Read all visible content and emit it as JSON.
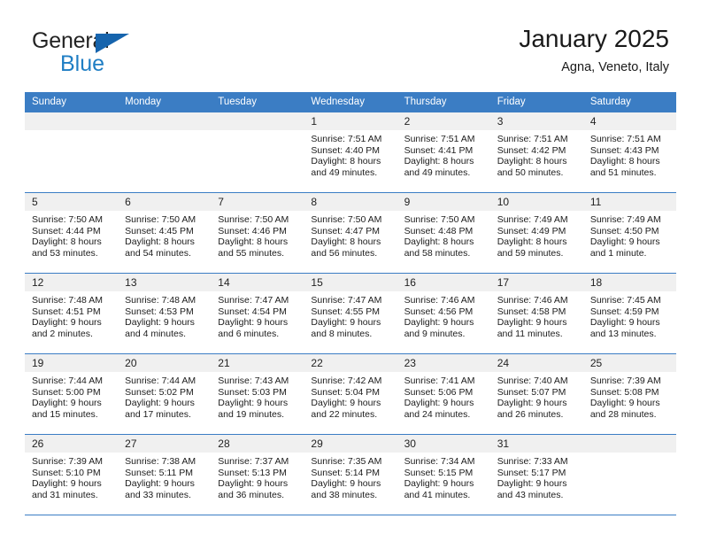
{
  "brand": {
    "name_top": "General",
    "name_bottom": "Blue",
    "triangle_color": "#1664ad",
    "blue_color": "#1f7ec4"
  },
  "header": {
    "title": "January 2025",
    "subtitle": "Agna, Veneto, Italy"
  },
  "theme": {
    "header_row_bg": "#3b7dc4",
    "header_row_text": "#ffffff",
    "daynum_bg": "#f0f0f0",
    "grid_line": "#3b7dc4"
  },
  "calendar": {
    "weekday_headers": [
      "Sunday",
      "Monday",
      "Tuesday",
      "Wednesday",
      "Thursday",
      "Friday",
      "Saturday"
    ],
    "labels": {
      "sunrise": "Sunrise:",
      "sunset": "Sunset:",
      "daylight": "Daylight:"
    },
    "weeks": [
      [
        {
          "day": "",
          "sunrise": "",
          "sunset": "",
          "daylight_line1": "",
          "daylight_line2": ""
        },
        {
          "day": "",
          "sunrise": "",
          "sunset": "",
          "daylight_line1": "",
          "daylight_line2": ""
        },
        {
          "day": "",
          "sunrise": "",
          "sunset": "",
          "daylight_line1": "",
          "daylight_line2": ""
        },
        {
          "day": "1",
          "sunrise": "Sunrise: 7:51 AM",
          "sunset": "Sunset: 4:40 PM",
          "daylight_line1": "Daylight: 8 hours",
          "daylight_line2": "and 49 minutes."
        },
        {
          "day": "2",
          "sunrise": "Sunrise: 7:51 AM",
          "sunset": "Sunset: 4:41 PM",
          "daylight_line1": "Daylight: 8 hours",
          "daylight_line2": "and 49 minutes."
        },
        {
          "day": "3",
          "sunrise": "Sunrise: 7:51 AM",
          "sunset": "Sunset: 4:42 PM",
          "daylight_line1": "Daylight: 8 hours",
          "daylight_line2": "and 50 minutes."
        },
        {
          "day": "4",
          "sunrise": "Sunrise: 7:51 AM",
          "sunset": "Sunset: 4:43 PM",
          "daylight_line1": "Daylight: 8 hours",
          "daylight_line2": "and 51 minutes."
        }
      ],
      [
        {
          "day": "5",
          "sunrise": "Sunrise: 7:50 AM",
          "sunset": "Sunset: 4:44 PM",
          "daylight_line1": "Daylight: 8 hours",
          "daylight_line2": "and 53 minutes."
        },
        {
          "day": "6",
          "sunrise": "Sunrise: 7:50 AM",
          "sunset": "Sunset: 4:45 PM",
          "daylight_line1": "Daylight: 8 hours",
          "daylight_line2": "and 54 minutes."
        },
        {
          "day": "7",
          "sunrise": "Sunrise: 7:50 AM",
          "sunset": "Sunset: 4:46 PM",
          "daylight_line1": "Daylight: 8 hours",
          "daylight_line2": "and 55 minutes."
        },
        {
          "day": "8",
          "sunrise": "Sunrise: 7:50 AM",
          "sunset": "Sunset: 4:47 PM",
          "daylight_line1": "Daylight: 8 hours",
          "daylight_line2": "and 56 minutes."
        },
        {
          "day": "9",
          "sunrise": "Sunrise: 7:50 AM",
          "sunset": "Sunset: 4:48 PM",
          "daylight_line1": "Daylight: 8 hours",
          "daylight_line2": "and 58 minutes."
        },
        {
          "day": "10",
          "sunrise": "Sunrise: 7:49 AM",
          "sunset": "Sunset: 4:49 PM",
          "daylight_line1": "Daylight: 8 hours",
          "daylight_line2": "and 59 minutes."
        },
        {
          "day": "11",
          "sunrise": "Sunrise: 7:49 AM",
          "sunset": "Sunset: 4:50 PM",
          "daylight_line1": "Daylight: 9 hours",
          "daylight_line2": "and 1 minute."
        }
      ],
      [
        {
          "day": "12",
          "sunrise": "Sunrise: 7:48 AM",
          "sunset": "Sunset: 4:51 PM",
          "daylight_line1": "Daylight: 9 hours",
          "daylight_line2": "and 2 minutes."
        },
        {
          "day": "13",
          "sunrise": "Sunrise: 7:48 AM",
          "sunset": "Sunset: 4:53 PM",
          "daylight_line1": "Daylight: 9 hours",
          "daylight_line2": "and 4 minutes."
        },
        {
          "day": "14",
          "sunrise": "Sunrise: 7:47 AM",
          "sunset": "Sunset: 4:54 PM",
          "daylight_line1": "Daylight: 9 hours",
          "daylight_line2": "and 6 minutes."
        },
        {
          "day": "15",
          "sunrise": "Sunrise: 7:47 AM",
          "sunset": "Sunset: 4:55 PM",
          "daylight_line1": "Daylight: 9 hours",
          "daylight_line2": "and 8 minutes."
        },
        {
          "day": "16",
          "sunrise": "Sunrise: 7:46 AM",
          "sunset": "Sunset: 4:56 PM",
          "daylight_line1": "Daylight: 9 hours",
          "daylight_line2": "and 9 minutes."
        },
        {
          "day": "17",
          "sunrise": "Sunrise: 7:46 AM",
          "sunset": "Sunset: 4:58 PM",
          "daylight_line1": "Daylight: 9 hours",
          "daylight_line2": "and 11 minutes."
        },
        {
          "day": "18",
          "sunrise": "Sunrise: 7:45 AM",
          "sunset": "Sunset: 4:59 PM",
          "daylight_line1": "Daylight: 9 hours",
          "daylight_line2": "and 13 minutes."
        }
      ],
      [
        {
          "day": "19",
          "sunrise": "Sunrise: 7:44 AM",
          "sunset": "Sunset: 5:00 PM",
          "daylight_line1": "Daylight: 9 hours",
          "daylight_line2": "and 15 minutes."
        },
        {
          "day": "20",
          "sunrise": "Sunrise: 7:44 AM",
          "sunset": "Sunset: 5:02 PM",
          "daylight_line1": "Daylight: 9 hours",
          "daylight_line2": "and 17 minutes."
        },
        {
          "day": "21",
          "sunrise": "Sunrise: 7:43 AM",
          "sunset": "Sunset: 5:03 PM",
          "daylight_line1": "Daylight: 9 hours",
          "daylight_line2": "and 19 minutes."
        },
        {
          "day": "22",
          "sunrise": "Sunrise: 7:42 AM",
          "sunset": "Sunset: 5:04 PM",
          "daylight_line1": "Daylight: 9 hours",
          "daylight_line2": "and 22 minutes."
        },
        {
          "day": "23",
          "sunrise": "Sunrise: 7:41 AM",
          "sunset": "Sunset: 5:06 PM",
          "daylight_line1": "Daylight: 9 hours",
          "daylight_line2": "and 24 minutes."
        },
        {
          "day": "24",
          "sunrise": "Sunrise: 7:40 AM",
          "sunset": "Sunset: 5:07 PM",
          "daylight_line1": "Daylight: 9 hours",
          "daylight_line2": "and 26 minutes."
        },
        {
          "day": "25",
          "sunrise": "Sunrise: 7:39 AM",
          "sunset": "Sunset: 5:08 PM",
          "daylight_line1": "Daylight: 9 hours",
          "daylight_line2": "and 28 minutes."
        }
      ],
      [
        {
          "day": "26",
          "sunrise": "Sunrise: 7:39 AM",
          "sunset": "Sunset: 5:10 PM",
          "daylight_line1": "Daylight: 9 hours",
          "daylight_line2": "and 31 minutes."
        },
        {
          "day": "27",
          "sunrise": "Sunrise: 7:38 AM",
          "sunset": "Sunset: 5:11 PM",
          "daylight_line1": "Daylight: 9 hours",
          "daylight_line2": "and 33 minutes."
        },
        {
          "day": "28",
          "sunrise": "Sunrise: 7:37 AM",
          "sunset": "Sunset: 5:13 PM",
          "daylight_line1": "Daylight: 9 hours",
          "daylight_line2": "and 36 minutes."
        },
        {
          "day": "29",
          "sunrise": "Sunrise: 7:35 AM",
          "sunset": "Sunset: 5:14 PM",
          "daylight_line1": "Daylight: 9 hours",
          "daylight_line2": "and 38 minutes."
        },
        {
          "day": "30",
          "sunrise": "Sunrise: 7:34 AM",
          "sunset": "Sunset: 5:15 PM",
          "daylight_line1": "Daylight: 9 hours",
          "daylight_line2": "and 41 minutes."
        },
        {
          "day": "31",
          "sunrise": "Sunrise: 7:33 AM",
          "sunset": "Sunset: 5:17 PM",
          "daylight_line1": "Daylight: 9 hours",
          "daylight_line2": "and 43 minutes."
        },
        {
          "day": "",
          "sunrise": "",
          "sunset": "",
          "daylight_line1": "",
          "daylight_line2": ""
        }
      ]
    ]
  }
}
